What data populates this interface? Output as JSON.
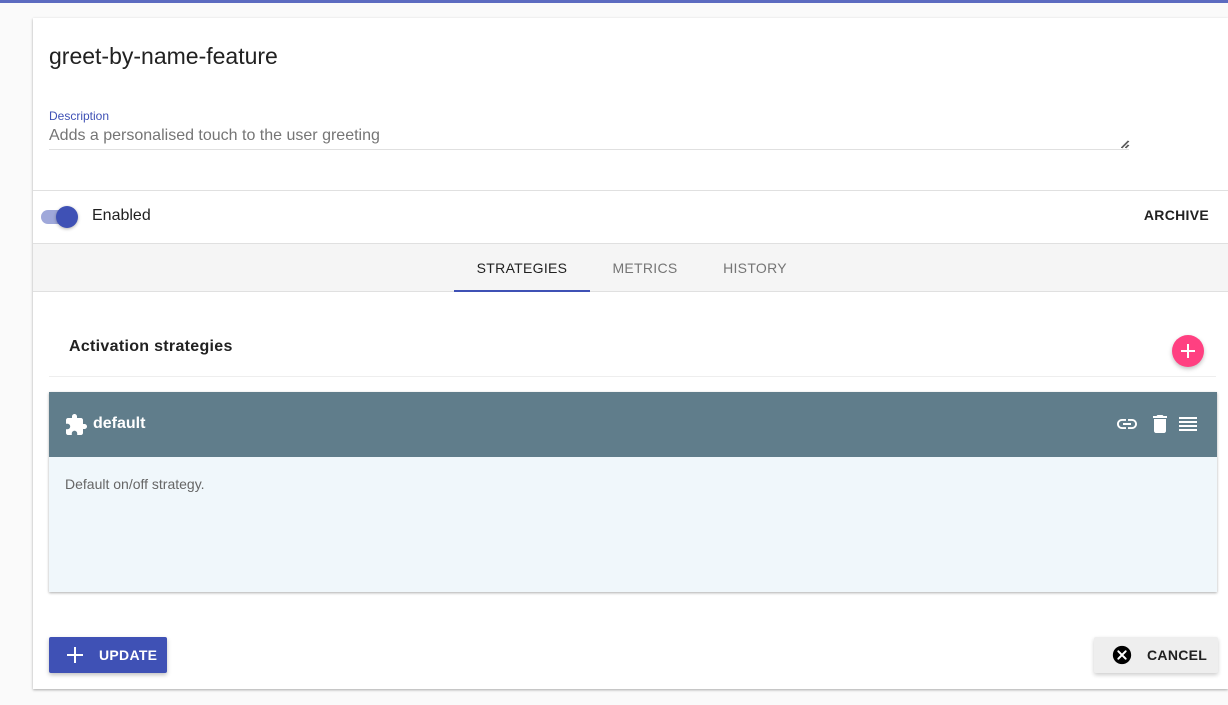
{
  "feature": {
    "name": "greet-by-name-feature",
    "description_label": "Description",
    "description_value": "Adds a personalised touch to the user greeting"
  },
  "status": {
    "enabled_label": "Enabled",
    "enabled": true,
    "archive_label": "ARCHIVE"
  },
  "tabs": [
    {
      "label": "STRATEGIES",
      "active": true
    },
    {
      "label": "METRICS",
      "active": false
    },
    {
      "label": "HISTORY",
      "active": false
    }
  ],
  "strategies_section": {
    "title": "Activation strategies",
    "items": [
      {
        "name": "default",
        "description": "Default on/off strategy."
      }
    ]
  },
  "actions": {
    "update_label": "UPDATE",
    "cancel_label": "CANCEL"
  },
  "colors": {
    "primary": "#3f51b5",
    "accent": "#ff4081",
    "strategy_header": "#607d8b",
    "strategy_body": "#f0f7fb"
  },
  "icons": {
    "strategy": "puzzle-icon",
    "link": "link-icon",
    "delete": "delete-icon",
    "drag": "drag-handle-icon",
    "add": "plus-icon",
    "cancel": "close-circle-icon"
  }
}
